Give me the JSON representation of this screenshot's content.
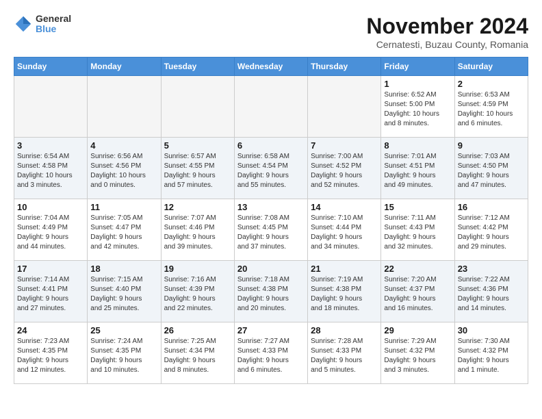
{
  "logo": {
    "line1": "General",
    "line2": "Blue"
  },
  "title": "November 2024",
  "subtitle": "Cernatesti, Buzau County, Romania",
  "weekdays": [
    "Sunday",
    "Monday",
    "Tuesday",
    "Wednesday",
    "Thursday",
    "Friday",
    "Saturday"
  ],
  "weeks": [
    {
      "shaded": false,
      "days": [
        {
          "date": "",
          "info": ""
        },
        {
          "date": "",
          "info": ""
        },
        {
          "date": "",
          "info": ""
        },
        {
          "date": "",
          "info": ""
        },
        {
          "date": "",
          "info": ""
        },
        {
          "date": "1",
          "info": "Sunrise: 6:52 AM\nSunset: 5:00 PM\nDaylight: 10 hours\nand 8 minutes."
        },
        {
          "date": "2",
          "info": "Sunrise: 6:53 AM\nSunset: 4:59 PM\nDaylight: 10 hours\nand 6 minutes."
        }
      ]
    },
    {
      "shaded": true,
      "days": [
        {
          "date": "3",
          "info": "Sunrise: 6:54 AM\nSunset: 4:58 PM\nDaylight: 10 hours\nand 3 minutes."
        },
        {
          "date": "4",
          "info": "Sunrise: 6:56 AM\nSunset: 4:56 PM\nDaylight: 10 hours\nand 0 minutes."
        },
        {
          "date": "5",
          "info": "Sunrise: 6:57 AM\nSunset: 4:55 PM\nDaylight: 9 hours\nand 57 minutes."
        },
        {
          "date": "6",
          "info": "Sunrise: 6:58 AM\nSunset: 4:54 PM\nDaylight: 9 hours\nand 55 minutes."
        },
        {
          "date": "7",
          "info": "Sunrise: 7:00 AM\nSunset: 4:52 PM\nDaylight: 9 hours\nand 52 minutes."
        },
        {
          "date": "8",
          "info": "Sunrise: 7:01 AM\nSunset: 4:51 PM\nDaylight: 9 hours\nand 49 minutes."
        },
        {
          "date": "9",
          "info": "Sunrise: 7:03 AM\nSunset: 4:50 PM\nDaylight: 9 hours\nand 47 minutes."
        }
      ]
    },
    {
      "shaded": false,
      "days": [
        {
          "date": "10",
          "info": "Sunrise: 7:04 AM\nSunset: 4:49 PM\nDaylight: 9 hours\nand 44 minutes."
        },
        {
          "date": "11",
          "info": "Sunrise: 7:05 AM\nSunset: 4:47 PM\nDaylight: 9 hours\nand 42 minutes."
        },
        {
          "date": "12",
          "info": "Sunrise: 7:07 AM\nSunset: 4:46 PM\nDaylight: 9 hours\nand 39 minutes."
        },
        {
          "date": "13",
          "info": "Sunrise: 7:08 AM\nSunset: 4:45 PM\nDaylight: 9 hours\nand 37 minutes."
        },
        {
          "date": "14",
          "info": "Sunrise: 7:10 AM\nSunset: 4:44 PM\nDaylight: 9 hours\nand 34 minutes."
        },
        {
          "date": "15",
          "info": "Sunrise: 7:11 AM\nSunset: 4:43 PM\nDaylight: 9 hours\nand 32 minutes."
        },
        {
          "date": "16",
          "info": "Sunrise: 7:12 AM\nSunset: 4:42 PM\nDaylight: 9 hours\nand 29 minutes."
        }
      ]
    },
    {
      "shaded": true,
      "days": [
        {
          "date": "17",
          "info": "Sunrise: 7:14 AM\nSunset: 4:41 PM\nDaylight: 9 hours\nand 27 minutes."
        },
        {
          "date": "18",
          "info": "Sunrise: 7:15 AM\nSunset: 4:40 PM\nDaylight: 9 hours\nand 25 minutes."
        },
        {
          "date": "19",
          "info": "Sunrise: 7:16 AM\nSunset: 4:39 PM\nDaylight: 9 hours\nand 22 minutes."
        },
        {
          "date": "20",
          "info": "Sunrise: 7:18 AM\nSunset: 4:38 PM\nDaylight: 9 hours\nand 20 minutes."
        },
        {
          "date": "21",
          "info": "Sunrise: 7:19 AM\nSunset: 4:38 PM\nDaylight: 9 hours\nand 18 minutes."
        },
        {
          "date": "22",
          "info": "Sunrise: 7:20 AM\nSunset: 4:37 PM\nDaylight: 9 hours\nand 16 minutes."
        },
        {
          "date": "23",
          "info": "Sunrise: 7:22 AM\nSunset: 4:36 PM\nDaylight: 9 hours\nand 14 minutes."
        }
      ]
    },
    {
      "shaded": false,
      "days": [
        {
          "date": "24",
          "info": "Sunrise: 7:23 AM\nSunset: 4:35 PM\nDaylight: 9 hours\nand 12 minutes."
        },
        {
          "date": "25",
          "info": "Sunrise: 7:24 AM\nSunset: 4:35 PM\nDaylight: 9 hours\nand 10 minutes."
        },
        {
          "date": "26",
          "info": "Sunrise: 7:25 AM\nSunset: 4:34 PM\nDaylight: 9 hours\nand 8 minutes."
        },
        {
          "date": "27",
          "info": "Sunrise: 7:27 AM\nSunset: 4:33 PM\nDaylight: 9 hours\nand 6 minutes."
        },
        {
          "date": "28",
          "info": "Sunrise: 7:28 AM\nSunset: 4:33 PM\nDaylight: 9 hours\nand 5 minutes."
        },
        {
          "date": "29",
          "info": "Sunrise: 7:29 AM\nSunset: 4:32 PM\nDaylight: 9 hours\nand 3 minutes."
        },
        {
          "date": "30",
          "info": "Sunrise: 7:30 AM\nSunset: 4:32 PM\nDaylight: 9 hours\nand 1 minute."
        }
      ]
    }
  ]
}
